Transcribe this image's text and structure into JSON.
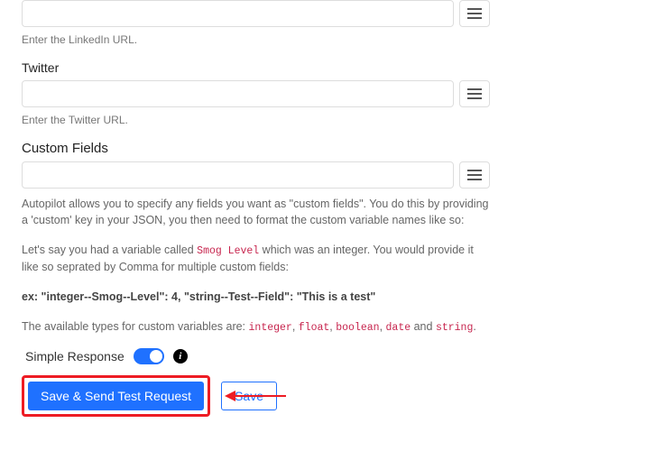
{
  "linkedin": {
    "value": "",
    "placeholder": "",
    "helper": "Enter the LinkedIn URL."
  },
  "twitter": {
    "label": "Twitter",
    "value": "",
    "placeholder": "",
    "helper": "Enter the Twitter URL."
  },
  "custom": {
    "label": "Custom Fields",
    "value": "",
    "placeholder": "",
    "p1_a": "Autopilot allows you to specify any fields you want as \"custom fields\". You do this by providing a 'custom' key in your JSON, you then need to format the custom variable names like so:",
    "p2_a": "Let's say you had a variable called ",
    "p2_code": "Smog Level",
    "p2_b": " which was an integer. You would provide it like so seprated by Comma for multiple custom fields:",
    "example": "ex: \"integer--Smog--Level\": 4, \"string--Test--Field\": \"This is a test\"",
    "p3_a": "The available types for custom variables are: ",
    "types": {
      "t1": "integer",
      "t2": "float",
      "t3": "boolean",
      "t4": "date",
      "t5": "string"
    },
    "p3_sep": ", ",
    "p3_and": " and ",
    "p3_end": "."
  },
  "controls": {
    "simple_response_label": "Simple Response",
    "simple_response_on": true
  },
  "buttons": {
    "primary": "Save & Send Test Request",
    "secondary": "Save"
  }
}
